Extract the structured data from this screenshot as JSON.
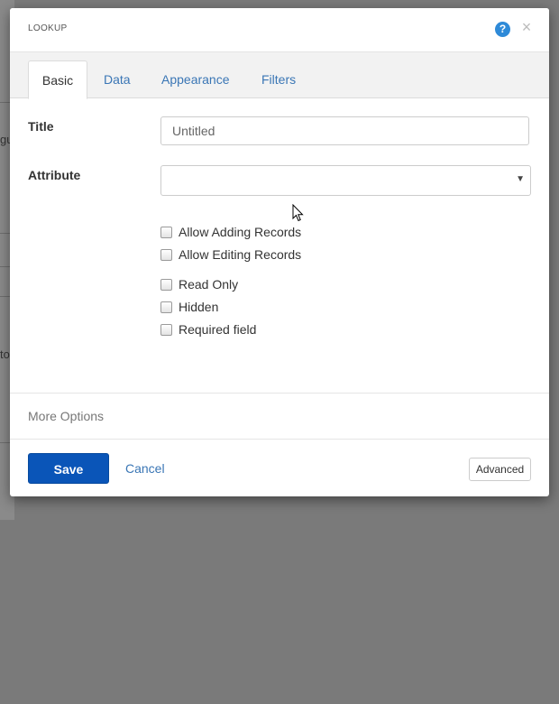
{
  "dialog": {
    "title": "LOOKUP",
    "help_icon": "?",
    "close_icon": "×"
  },
  "tabs": [
    {
      "label": "Basic",
      "active": true
    },
    {
      "label": "Data",
      "active": false
    },
    {
      "label": "Appearance",
      "active": false
    },
    {
      "label": "Filters",
      "active": false
    }
  ],
  "form": {
    "title_label": "Title",
    "title_value": "Untitled",
    "attribute_label": "Attribute",
    "attribute_value": "",
    "attribute_arrow": "▼",
    "checkboxes": [
      {
        "label": "Allow Adding Records",
        "checked": false
      },
      {
        "label": "Allow Editing Records",
        "checked": false
      },
      {
        "label": "Read Only",
        "checked": false
      },
      {
        "label": "Hidden",
        "checked": false
      },
      {
        "label": "Required field",
        "checked": false
      }
    ]
  },
  "more_options_label": "More Options",
  "footer": {
    "save_label": "Save",
    "cancel_label": "Cancel",
    "advanced_label": "Advanced"
  },
  "background": {
    "glyph_1": "gu",
    "glyph_2": "to"
  },
  "colors": {
    "overlay": "#7a7a7a",
    "primary_button": "#0a55b8",
    "link": "#3a76b5",
    "help_icon": "#2e8ad8"
  }
}
